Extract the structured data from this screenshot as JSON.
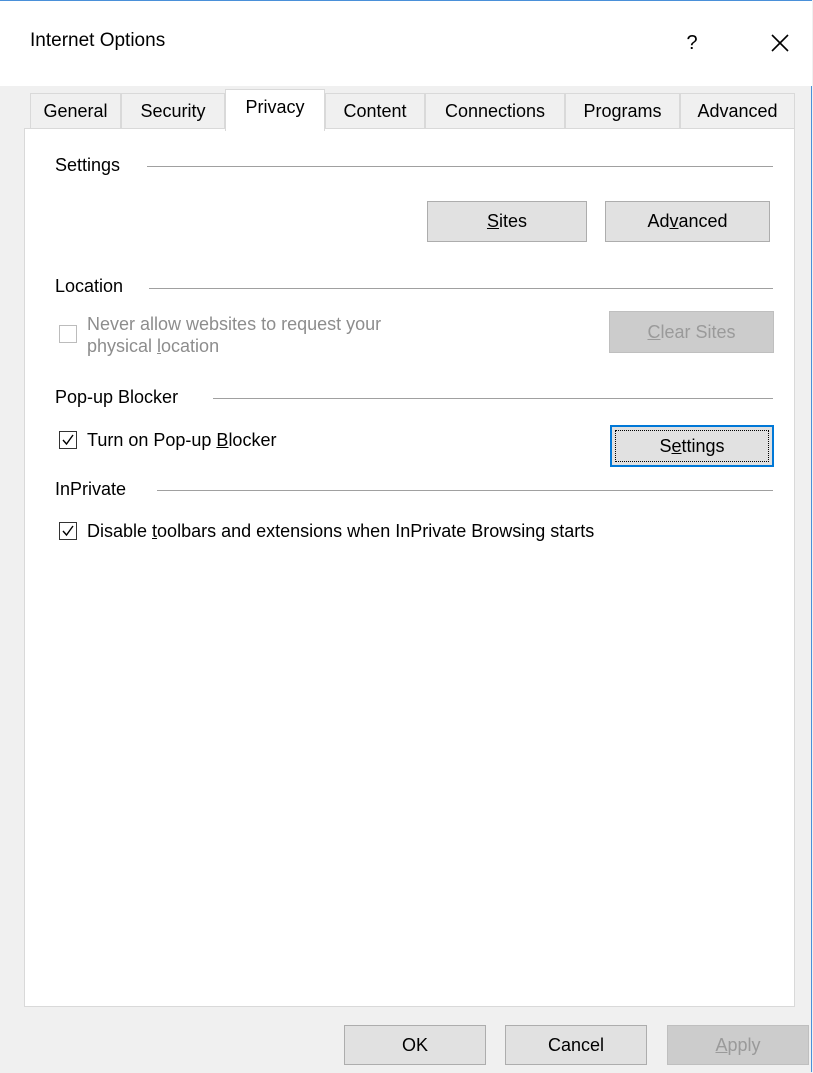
{
  "window": {
    "title": "Internet Options",
    "help_label": "?",
    "icons": {
      "close": "close-icon"
    }
  },
  "tabs": [
    {
      "label": "General"
    },
    {
      "label": "Security"
    },
    {
      "label": "Privacy",
      "active": true
    },
    {
      "label": "Content"
    },
    {
      "label": "Connections"
    },
    {
      "label": "Programs"
    },
    {
      "label": "Advanced"
    }
  ],
  "settings": {
    "heading": "Settings",
    "sites_button": {
      "pre": "",
      "mnemonic": "S",
      "post": "ites"
    },
    "advanced_button": {
      "pre": "Ad",
      "mnemonic": "v",
      "post": "anced"
    }
  },
  "location": {
    "heading": "Location",
    "checkbox_line1": "Never allow websites to request your",
    "checkbox_line2_pre": "physical ",
    "checkbox_line2_mnemonic": "l",
    "checkbox_line2_post": "ocation",
    "checked": false,
    "enabled": false,
    "clear_sites_button": {
      "pre": "",
      "mnemonic": "C",
      "post": "lear Sites"
    }
  },
  "popup_blocker": {
    "heading": "Pop-up Blocker",
    "checkbox_pre": "Turn on Pop-up ",
    "checkbox_mnemonic": "B",
    "checkbox_post": "locker",
    "checked": true,
    "settings_button": {
      "pre": "S",
      "mnemonic": "e",
      "post": "ttings"
    }
  },
  "inprivate": {
    "heading": "InPrivate",
    "checkbox_pre": "Disable ",
    "checkbox_mnemonic": "t",
    "checkbox_post": "oolbars and extensions when InPrivate Browsing starts",
    "checked": true
  },
  "footer": {
    "ok": "OK",
    "cancel": "Cancel",
    "apply_mnemonic": "A",
    "apply_post": "pply"
  }
}
